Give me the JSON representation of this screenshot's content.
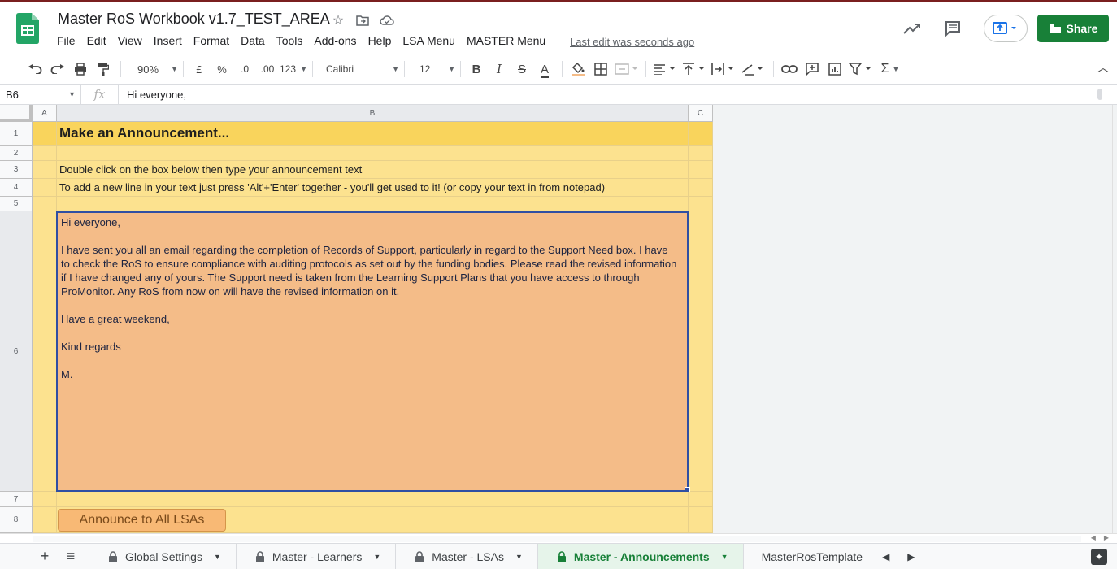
{
  "app": {
    "title": "Master RoS Workbook v1.7_TEST_AREA",
    "last_edit": "Last edit was seconds ago",
    "share_label": "Share",
    "brand_color": "#188038"
  },
  "menu": [
    "File",
    "Edit",
    "View",
    "Insert",
    "Format",
    "Data",
    "Tools",
    "Add-ons",
    "Help",
    "LSA Menu",
    "MASTER Menu"
  ],
  "toolbar": {
    "zoom": "90%",
    "currency": "£",
    "percent": "%",
    "dec_less": ".0",
    "dec_more": ".00",
    "more_formats": "123",
    "font": "Calibri",
    "font_size": "12",
    "bold": "B",
    "italic": "I",
    "strike": "S",
    "text_color": "A",
    "sum": "Σ"
  },
  "formula_bar": {
    "cell_ref": "B6",
    "fx": "fx",
    "value": "Hi everyone,"
  },
  "grid": {
    "columns": [
      "A",
      "B",
      "C"
    ],
    "rows": [
      "1",
      "2",
      "3",
      "4",
      "5",
      "6",
      "7",
      "8"
    ],
    "cells": {
      "b1": "Make an Announcement...",
      "b3": "Double click on the box below then type your announcement text",
      "b4": "To add a new line in your text just press 'Alt'+'Enter' together - you'll get used to it! (or copy your text in from notepad)"
    },
    "announcement": {
      "greeting": "Hi everyone,",
      "line1": "I have sent you all an email regarding the completion of Records of Support, particularly in regard to the Support Need box. I have",
      "line2": "to check the RoS to ensure compliance with auditing protocols as set out by the funding bodies. Please read the revised information",
      "line3": "if I have changed any of yours. The Support need is taken from the Learning Support Plans that you have access to through",
      "line4": "ProMonitor. Any RoS from now on will have the revised information on it.",
      "closing1": "Have a great weekend,",
      "closing2": "Kind regards",
      "signature": "M."
    },
    "button_label": "Announce to All LSAs"
  },
  "tabs": [
    {
      "label": "Global Settings",
      "active": false
    },
    {
      "label": "Master - Learners",
      "active": false
    },
    {
      "label": "Master - LSAs",
      "active": false
    },
    {
      "label": "Master - Announcements",
      "active": true
    },
    {
      "label": "MasterRosTemplate",
      "active": false
    }
  ],
  "icons": [
    "undo-icon",
    "redo-icon",
    "print-icon",
    "paint-format-icon",
    "star-icon",
    "move-icon",
    "cloud-icon",
    "trending-icon",
    "comment-icon",
    "present-icon",
    "lock-icon",
    "add-sheet-icon",
    "all-sheets-icon",
    "explore-icon"
  ]
}
